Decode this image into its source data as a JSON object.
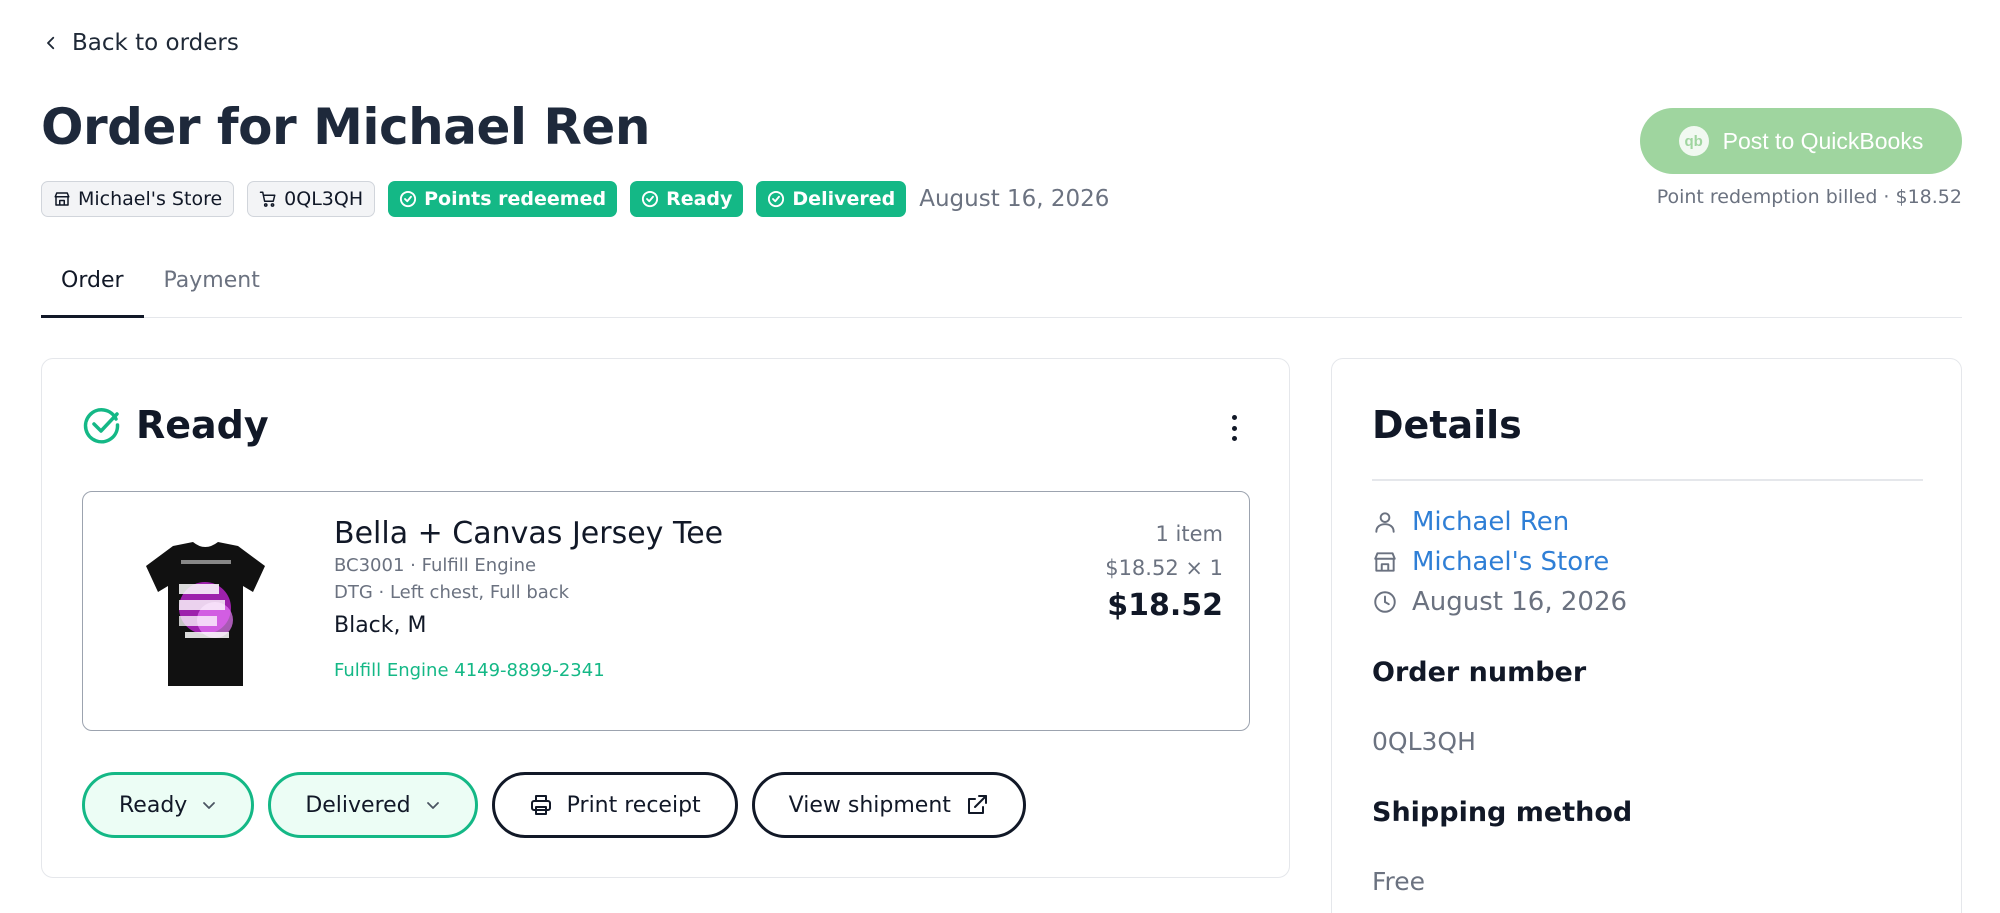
{
  "nav": {
    "back_label": "Back to orders"
  },
  "header": {
    "title": "Order for Michael Ren",
    "badges": {
      "store": "Michael's Store",
      "order_code": "0QL3QH",
      "points": "Points redeemed",
      "ready": "Ready",
      "delivered": "Delivered"
    },
    "date": "August 16, 2026",
    "qb_button_label": "Post to QuickBooks",
    "qb_icon_text": "qb",
    "qb_note": "Point redemption billed · $18.52"
  },
  "tabs": [
    {
      "label": "Order",
      "active": true
    },
    {
      "label": "Payment",
      "active": false
    }
  ],
  "order_card": {
    "status_title": "Ready",
    "item": {
      "name": "Bella + Canvas Jersey Tee",
      "sku_line": "BC3001 · Fulfill Engine",
      "print_line": "DTG · Left chest, Full back",
      "variant": "Black, M",
      "tracking": "Fulfill Engine 4149-8899-2341",
      "count": "1 item",
      "unit_price": "$18.52 × 1",
      "total": "$18.52"
    },
    "actions": {
      "status_select": "Ready",
      "delivery_select": "Delivered",
      "print_receipt": "Print receipt",
      "view_shipment": "View shipment"
    }
  },
  "details": {
    "title": "Details",
    "customer": "Michael Ren",
    "store": "Michael's Store",
    "date": "August 16, 2026",
    "order_number_label": "Order number",
    "order_number": "0QL3QH",
    "shipping_label": "Shipping method",
    "shipping_value": "Free"
  },
  "colors": {
    "accent_green": "#14b886",
    "quickbooks_green": "#9fd59f",
    "link_blue": "#2f7fd6",
    "text_dark": "#1e293b"
  },
  "icons": [
    "chevron-left-icon",
    "store-icon",
    "cart-icon",
    "check-circle-icon",
    "quickbooks-icon",
    "kebab-menu-icon",
    "chevron-down-icon",
    "printer-icon",
    "external-link-icon",
    "user-icon",
    "clock-icon"
  ]
}
